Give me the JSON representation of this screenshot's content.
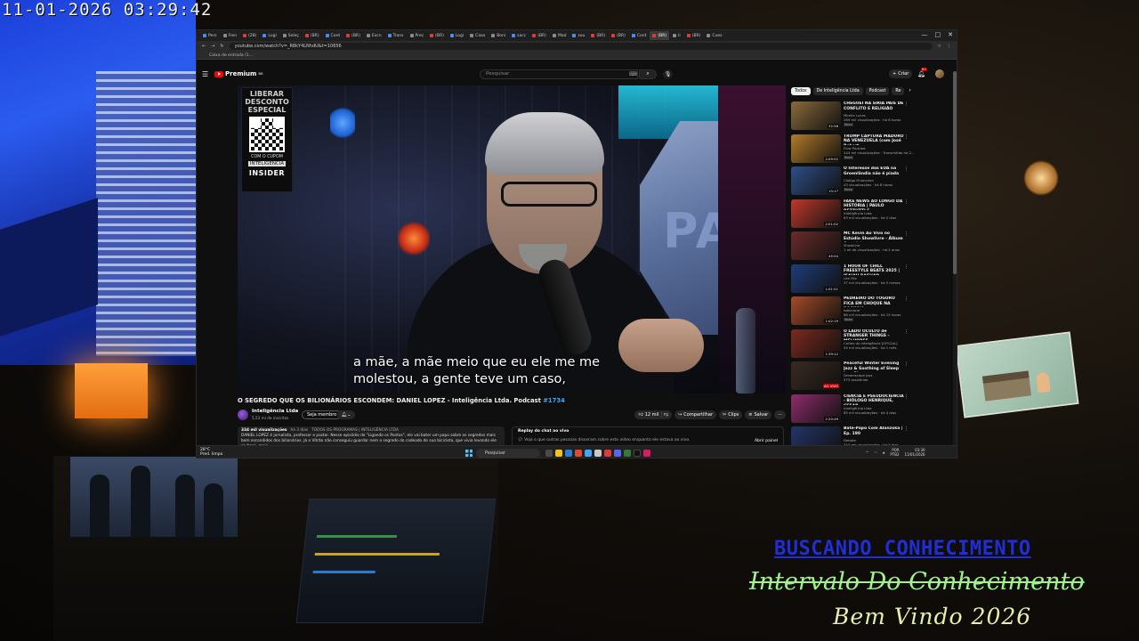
{
  "camera_timestamp": "11-01-2026 03:29:42",
  "overlay": {
    "line1": "BUSCANDO CONHECIMENTO",
    "line2": "Intervalo Do Conhecimento",
    "line3": "Bem Vindo 2026"
  },
  "browser": {
    "tabs": [
      "Pers",
      "Fren",
      "(28)",
      "Logi",
      "Seleç",
      "(BR)",
      "Cont",
      "(BR)",
      "Excn",
      "Trans",
      "Prec",
      "(BR)",
      "Logi",
      "Casa",
      "Boni",
      "sacc",
      "(BR)",
      "Mad",
      "sou",
      "(BR)",
      "(BR)",
      "Cont",
      "(BR)",
      "Ii",
      "(BR)",
      "Cues"
    ],
    "active_tab_index": 22,
    "url": "youtube.com/watch?v=_R8kY4LNhdU&t=10656",
    "bookmark": "Caixa de entrada (1..."
  },
  "youtube": {
    "logo_text": "Premium",
    "logo_sup": "BR",
    "search_placeholder": "Pesquisar",
    "create_label": "Criar",
    "bell_badge": "9+",
    "video": {
      "promo": {
        "line1": "LIBERAR DESCONTO ESPECIAL",
        "line2": "COM O CUPOM",
        "coupon": "INTELIGENCIA",
        "brand": "INSIDER"
      },
      "subtitle_1": "a mãe, a mãe meio que eu ele me me",
      "subtitle_2": "molestou, a gente teve um caso,",
      "sign_text": "PARE"
    },
    "title": "O SEGREDO QUE OS BILIONÁRIOS ESCONDEM: DANIEL LOPEZ - Inteligência Ltda. Podcast",
    "title_tag": "#1734",
    "channel": {
      "name": "Inteligência Ltda",
      "subscribers": "5,53 mi de inscritos",
      "join_label": "Seja membro"
    },
    "actions": {
      "likes": "12 mil",
      "share": "Compartilhar",
      "clips": "Clips",
      "save": "Salvar",
      "more": "···"
    },
    "description": {
      "views": "334 mil visualizações",
      "age": "há 3 dias",
      "tags": "TODOS OS PROGRAMAS | INTELIGÊNCIA LTDA",
      "text": "DANIEL LOPEZ é jornalista, professor e pastor. Nesse episódio de \"Ligando os Pontos\", ele vai bater um papo sobre os segredos mais bem escondidos dos bilionários. Já o Vitrão não conseguiu guardar nem o segredo do cadeado de sua bicicleta, que vivia levando ele roubar/...mais"
    },
    "chat": {
      "header": "Replay do chat ao vivo",
      "text": "Veja o que outras pessoas disseram sobre este vídeo enquanto ele estava ao vivo.",
      "open_label": "Abrir painel"
    },
    "chips": [
      "Todos",
      "De Inteligência Ltda",
      "Podcast",
      "Re"
    ],
    "recommendations": [
      {
        "title": "CHEGUEI NA SÍRIA PAÍS DE CONFLITO E RELIGIÃO",
        "channel": "Mirelle Lucas",
        "meta": "269 mil visualizações · há 8 horas",
        "badge": "Novo",
        "duration": "32:56",
        "thumb": "#8a6b3c"
      },
      {
        "title": "TRUMP CAPTURA MADURO NA VENEZUELA (com José Robert...",
        "channel": "Flow Podcast",
        "meta": "244 mil visualizações · Transmitido há 2...",
        "badge": "Novo",
        "duration": "2:09:52",
        "thumb": "#b37b2a"
      },
      {
        "title": "O Interesse dos EUA na Groenlândia não é piada",
        "channel": "Código Financeiro",
        "meta": "43 visualizações · há 8 horas",
        "badge": "Novo",
        "duration": "15:17",
        "thumb": "#2f4f86"
      },
      {
        "title": "FAKE NEWS AO LONGO DA HISTÓRIA | PAULO REZZUTTI E ...",
        "channel": "Inteligência Ltda",
        "meta": "63 mil visualizações · há 5 dias",
        "badge": "",
        "duration": "2:01:02",
        "thumb": "#c0392b"
      },
      {
        "title": "MC Kevin Ao Vivo no Estúdio Showlivre - Álbum Completo",
        "channel": "Showlivre",
        "meta": "1 mi de visualizações · há 4 anos",
        "badge": "",
        "duration": "45:04",
        "thumb": "#6b2b2b"
      },
      {
        "title": "1 HOUR OF CHILL FREESTYLE BEATS 2025 | ISAIAH RASHAD...",
        "channel": "Lite Mix",
        "meta": "37 mil visualizações · há 5 meses",
        "badge": "",
        "duration": "1:01:51",
        "thumb": "#1f3d7a"
      },
      {
        "title": "PEDREIRO DO TOGURO FICA EM CHOQUE NA ROCINHA ...",
        "channel": "toblerone",
        "meta": "88 mil visualizações · há 15 horas",
        "badge": "Novo",
        "duration": "1:02:19",
        "thumb": "#a64b2a"
      },
      {
        "title": "O LADO OCULTO de STRANGER THINGS - MELHORES ...",
        "channel": "Cortes do Inteligência [OFICIAL]",
        "meta": "54 mil visualizações · há 1 mês",
        "badge": "",
        "duration": "1:39:12",
        "thumb": "#7d2a1f"
      },
      {
        "title": "Peaceful Winter Evening Jazz & Soothing of Sleep Jazz Piano ...",
        "channel": "Dreamscape Jazz",
        "meta": "573 assistindo",
        "badge": "",
        "duration": "AO VIVO",
        "thumb": "#3a2a22"
      },
      {
        "title": "CIÊNCIA E PSEUDOCIÊNCIA - BIÓLOGO HENRIQUE, CESAR ...",
        "channel": "Inteligência Ltda",
        "meta": "85 mil visualizações · há 4 dias",
        "badge": "",
        "duration": "2:20:49",
        "thumb": "#8e2d6b"
      },
      {
        "title": "Bate-Papo Com Alanzoka | Ep. 190",
        "channel": "Debate",
        "meta": "744 mil visualizações · há 5 dias",
        "badge": "",
        "duration": "1:23:46",
        "thumb": "#24346b"
      }
    ]
  },
  "taskbar": {
    "temp": "28°C",
    "weather": "Pred. limpo",
    "search": "Pesquisar",
    "lang1": "POR",
    "lang2": "PTB2",
    "time": "03:30",
    "date": "11/01/2026"
  }
}
